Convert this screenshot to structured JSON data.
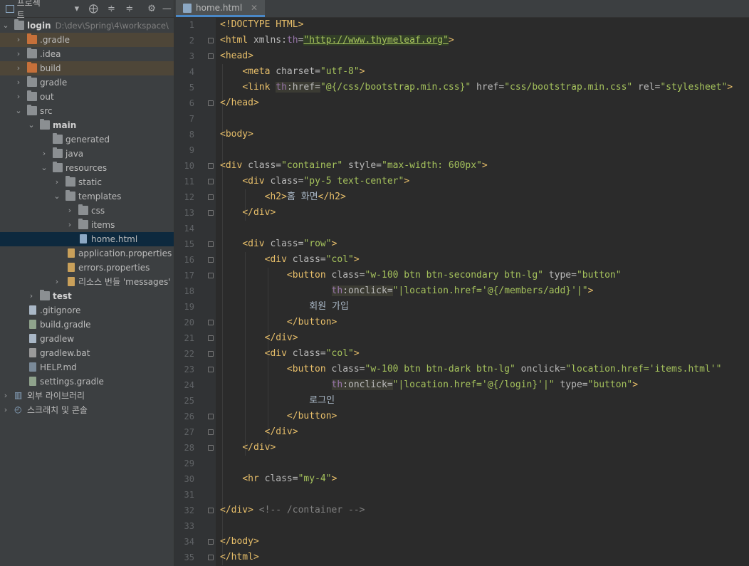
{
  "project": {
    "title": "프로젝트",
    "toolbar_icons": [
      "project-icon",
      "chevron-down-icon",
      "locate-icon",
      "expand-all-icon",
      "collapse-all-icon",
      "gear-icon",
      "minimize-icon"
    ],
    "root_name": "login",
    "root_path": "D:\\dev\\Spring\\4\\workspace\\",
    "items": [
      {
        "label": ".gradle"
      },
      {
        "label": ".idea"
      },
      {
        "label": "build"
      },
      {
        "label": "gradle"
      },
      {
        "label": "out"
      },
      {
        "label": "src"
      },
      {
        "label": "main"
      },
      {
        "label": "generated"
      },
      {
        "label": "java"
      },
      {
        "label": "resources"
      },
      {
        "label": "static"
      },
      {
        "label": "templates"
      },
      {
        "label": "css"
      },
      {
        "label": "items"
      },
      {
        "label": "home.html"
      },
      {
        "label": "application.properties"
      },
      {
        "label": "errors.properties"
      },
      {
        "label": "리소스 번들 'messages'"
      },
      {
        "label": "test"
      },
      {
        "label": ".gitignore"
      },
      {
        "label": "build.gradle"
      },
      {
        "label": "gradlew"
      },
      {
        "label": "gradlew.bat"
      },
      {
        "label": "HELP.md"
      },
      {
        "label": "settings.gradle"
      },
      {
        "label": "외부 라이브러리"
      },
      {
        "label": "스크래치 및 콘솔"
      }
    ]
  },
  "editor": {
    "tab_label": "home.html",
    "lines": [
      "1",
      "2",
      "3",
      "4",
      "5",
      "6",
      "7",
      "8",
      "9",
      "10",
      "11",
      "12",
      "13",
      "14",
      "15",
      "16",
      "17",
      "18",
      "19",
      "20",
      "21",
      "22",
      "23",
      "24",
      "25",
      "26",
      "27",
      "28",
      "29",
      "30",
      "31",
      "32",
      "33",
      "34",
      "35"
    ],
    "text": {
      "doctype": "<!DOCTYPE HTML>",
      "html_open": "<html",
      "xmlns": " xmlns:",
      "th": "th",
      "eq": "=",
      "url": "\"http://www.thymeleaf.org\"",
      "gt": ">",
      "head_open": "<head>",
      "meta": "<meta",
      "charset": " charset=",
      "charset_val": "\"utf-8\"",
      "link": "<link",
      "href_attr": ":href=",
      "thhref_val": "\"@{/css/bootstrap.min.css}\"",
      "href2": " href=",
      "href2_val": "\"css/bootstrap.min.css\"",
      "rel": " rel=",
      "rel_val": "\"stylesheet\"",
      "head_close": "</head>",
      "body_open": "<body>",
      "div_open": "<div",
      "class": " class=",
      "container_val": "\"container\"",
      "style": " style=",
      "style_val": "\"max-width: 600px\"",
      "py_val": "\"py-5 text-center\"",
      "h2_open": "<h2>",
      "h2_text": "홈 화면",
      "h2_close": "</h2>",
      "div_close": "</div>",
      "row_val": "\"row\"",
      "col_val": "\"col\"",
      "button_open": "<button",
      "btn1_val": "\"w-100 btn btn-secondary btn-lg\"",
      "type": " type=",
      "type_val": "\"button\"",
      "onclick": ":onclick=",
      "onclick1_val": "\"|location.href='@{/members/add}'|\"",
      "join_text": "회원 가입",
      "button_close": "</button>",
      "btn2_val": "\"w-100 btn btn-dark btn-lg\"",
      "onclick_plain": " onclick=",
      "onclick2_plain_val": "\"location.href='items.html'\"",
      "onclick2_val": "\"|location.href='@{/login}'|\"",
      "login_text": "로그인",
      "hr_open": "<hr",
      "hr_val": "\"my-4\"",
      "comment": " <!-- /container -->",
      "body_close": "</body>",
      "html_close": "</html>"
    }
  }
}
